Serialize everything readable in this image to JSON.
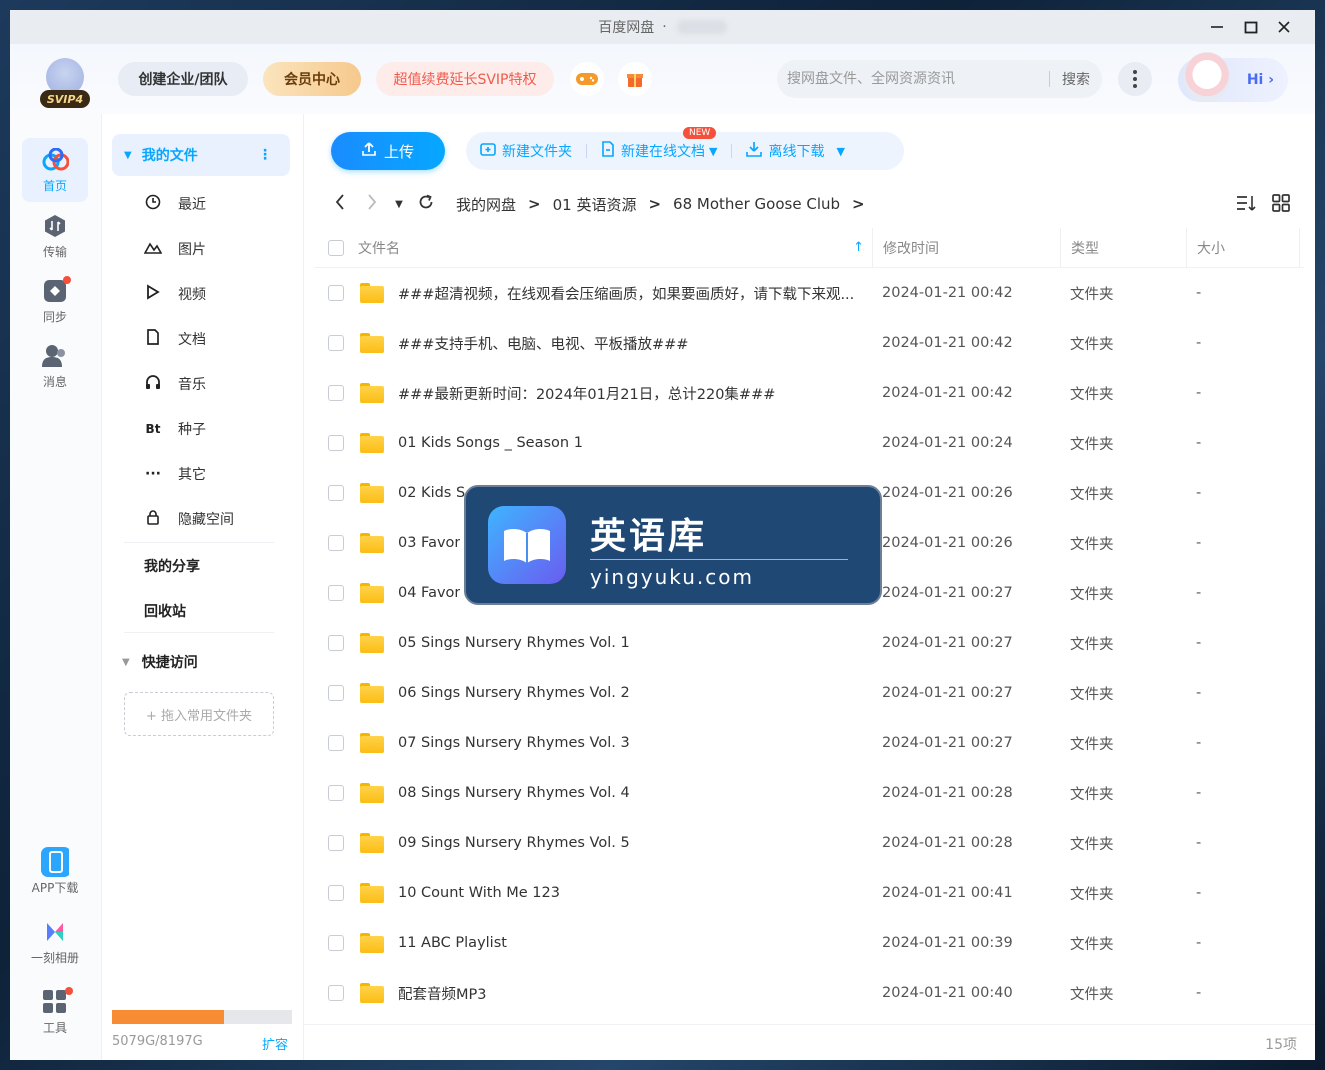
{
  "window": {
    "title": "百度网盘",
    "title_sep": "·"
  },
  "header": {
    "avatar_badge": "SVIP4",
    "team_button": "创建企业/团队",
    "vip_button": "会员中心",
    "svip_button": "超值续费延长SVIP特权",
    "search_placeholder": "搜网盘文件、全网资源资讯",
    "search_button": "搜索",
    "hi_button": "Hi ›"
  },
  "rail": {
    "items": [
      {
        "label": "首页",
        "icon": "home-icon"
      },
      {
        "label": "传输",
        "icon": "transfer-icon"
      },
      {
        "label": "同步",
        "icon": "sync-icon"
      },
      {
        "label": "消息",
        "icon": "message-icon"
      },
      {
        "label": "APP下载",
        "icon": "phone-icon"
      },
      {
        "label": "一刻相册",
        "icon": "album-icon"
      },
      {
        "label": "工具",
        "icon": "tools-icon"
      }
    ]
  },
  "sidenav": {
    "my_files": "我的文件",
    "items": [
      {
        "label": "最近",
        "icon": "clock-icon"
      },
      {
        "label": "图片",
        "icon": "image-icon"
      },
      {
        "label": "视频",
        "icon": "play-icon"
      },
      {
        "label": "文档",
        "icon": "doc-icon"
      },
      {
        "label": "音乐",
        "icon": "headphone-icon"
      },
      {
        "label": "种子",
        "icon": "bt-icon"
      },
      {
        "label": "其它",
        "icon": "more-icon"
      },
      {
        "label": "隐藏空间",
        "icon": "lock-icon"
      }
    ],
    "my_share": "我的分享",
    "recycle": "回收站",
    "quick_access": "快捷访问",
    "drop_folder": "+ 拖入常用文件夹",
    "quota_used_fraction": 0.62,
    "quota_text": "5079G/8197G",
    "expand": "扩容"
  },
  "toolbar": {
    "upload": "上传",
    "new_folder": "新建文件夹",
    "new_online_doc": "新建在线文档",
    "new_badge": "NEW",
    "offline_download": "离线下载"
  },
  "breadcrumb": {
    "items": [
      "我的网盘",
      "01 英语资源",
      "68 Mother Goose Club"
    ]
  },
  "table": {
    "headers": {
      "name": "文件名",
      "mtime": "修改时间",
      "type": "类型",
      "size": "大小"
    },
    "rows": [
      {
        "name": "###超清视频，在线观看会压缩画质，如果要画质好，请下载下来观...",
        "mtime": "2024-01-21 00:42",
        "type": "文件夹",
        "size": "-"
      },
      {
        "name": "###支持手机、电脑、电视、平板播放###",
        "mtime": "2024-01-21 00:42",
        "type": "文件夹",
        "size": "-"
      },
      {
        "name": "###最新更新时间：2024年01月21日，总计220集###",
        "mtime": "2024-01-21 00:42",
        "type": "文件夹",
        "size": "-"
      },
      {
        "name": "01 Kids Songs _ Season 1",
        "mtime": "2024-01-21 00:24",
        "type": "文件夹",
        "size": "-"
      },
      {
        "name": "02 Kids S",
        "mtime": "2024-01-21 00:26",
        "type": "文件夹",
        "size": "-"
      },
      {
        "name": "03 Favor",
        "mtime": "2024-01-21 00:26",
        "type": "文件夹",
        "size": "-"
      },
      {
        "name": "04 Favor",
        "mtime": "2024-01-21 00:27",
        "type": "文件夹",
        "size": "-"
      },
      {
        "name": "05 Sings Nursery Rhymes Vol. 1",
        "mtime": "2024-01-21 00:27",
        "type": "文件夹",
        "size": "-"
      },
      {
        "name": "06 Sings Nursery Rhymes Vol. 2",
        "mtime": "2024-01-21 00:27",
        "type": "文件夹",
        "size": "-"
      },
      {
        "name": "07 Sings Nursery Rhymes Vol. 3",
        "mtime": "2024-01-21 00:27",
        "type": "文件夹",
        "size": "-"
      },
      {
        "name": "08 Sings Nursery Rhymes Vol. 4",
        "mtime": "2024-01-21 00:28",
        "type": "文件夹",
        "size": "-"
      },
      {
        "name": "09 Sings Nursery Rhymes Vol. 5",
        "mtime": "2024-01-21 00:28",
        "type": "文件夹",
        "size": "-"
      },
      {
        "name": "10 Count With Me 123",
        "mtime": "2024-01-21 00:41",
        "type": "文件夹",
        "size": "-"
      },
      {
        "name": "11 ABC Playlist",
        "mtime": "2024-01-21 00:39",
        "type": "文件夹",
        "size": "-"
      },
      {
        "name": "配套音频MP3",
        "mtime": "2024-01-21 00:40",
        "type": "文件夹",
        "size": "-"
      }
    ],
    "count": "15项"
  },
  "watermark": {
    "title": "英语库",
    "subtitle": "yingyuku.com"
  },
  "colors": {
    "accent": "#06a7ff",
    "quota": "#f78c35",
    "folder": "#fbbd14"
  }
}
